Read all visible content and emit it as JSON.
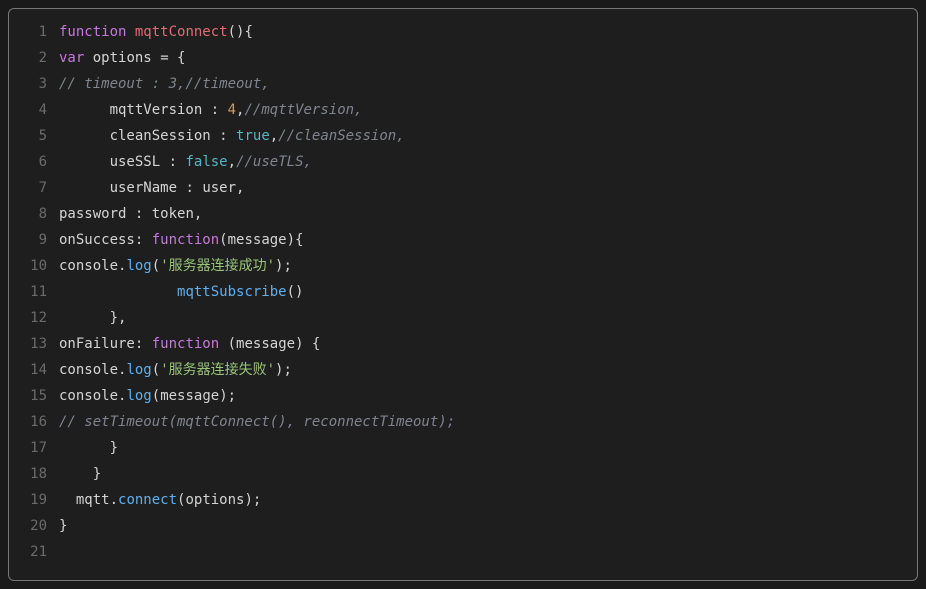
{
  "lines": [
    {
      "n": "1",
      "html": "<span class='kw'>function</span> <span class='fnname'>mqttConnect</span><span class='punc'>(){</span>"
    },
    {
      "n": "2",
      "html": "<span class='kw'>var</span> <span class='obj'>options</span> <span class='punc'>= {</span>"
    },
    {
      "n": "3",
      "html": "<span class='cmt'>// timeout : 3,//timeout,</span>"
    },
    {
      "n": "4",
      "html": "      <span class='prop'>mqttVersion</span> <span class='punc'>:</span> <span class='num'>4</span><span class='punc'>,</span><span class='cmt'>//mqttVersion,</span>"
    },
    {
      "n": "5",
      "html": "      <span class='prop'>cleanSession</span> <span class='punc'>:</span> <span class='bool'>true</span><span class='punc'>,</span><span class='cmt'>//cleanSession,</span>"
    },
    {
      "n": "6",
      "html": "      <span class='prop'>useSSL</span> <span class='punc'>:</span> <span class='bool'>false</span><span class='punc'>,</span><span class='cmt'>//useTLS,</span>"
    },
    {
      "n": "7",
      "html": "      <span class='prop'>userName</span> <span class='punc'>:</span> <span class='obj'>user</span><span class='punc'>,</span>"
    },
    {
      "n": "8",
      "html": "<span class='prop'>password</span> <span class='punc'>:</span> <span class='obj'>token</span><span class='punc'>,</span>"
    },
    {
      "n": "9",
      "html": "<span class='prop'>onSuccess</span><span class='punc'>:</span> <span class='kw'>function</span><span class='punc'>(</span><span class='obj'>message</span><span class='punc'>){</span>"
    },
    {
      "n": "10",
      "html": "<span class='obj'>console</span><span class='punc'>.</span><span class='fn'>log</span><span class='punc'>(</span><span class='str'>'服务器连接成功'</span><span class='punc'>);</span>"
    },
    {
      "n": "11",
      "html": "              <span class='call'>mqttSubscribe</span><span class='punc'>()</span>"
    },
    {
      "n": "12",
      "html": "      <span class='punc'>},</span>"
    },
    {
      "n": "13",
      "html": "<span class='prop'>onFailure</span><span class='punc'>:</span> <span class='kw'>function</span> <span class='punc'>(</span><span class='obj'>message</span><span class='punc'>) {</span>"
    },
    {
      "n": "14",
      "html": "<span class='obj'>console</span><span class='punc'>.</span><span class='fn'>log</span><span class='punc'>(</span><span class='str'>'服务器连接失败'</span><span class='punc'>);</span>"
    },
    {
      "n": "15",
      "html": "<span class='obj'>console</span><span class='punc'>.</span><span class='fn'>log</span><span class='punc'>(</span><span class='obj'>message</span><span class='punc'>);</span>"
    },
    {
      "n": "16",
      "html": "<span class='cmt'>// setTimeout(mqttConnect(), reconnectTimeout);</span>"
    },
    {
      "n": "17",
      "html": "      <span class='punc'>}</span>"
    },
    {
      "n": "18",
      "html": "    <span class='punc'>}</span>"
    },
    {
      "n": "19",
      "html": "  <span class='obj'>mqtt</span><span class='punc'>.</span><span class='fn'>connect</span><span class='punc'>(</span><span class='obj'>options</span><span class='punc'>);</span>"
    },
    {
      "n": "20",
      "html": "<span class='punc'>}</span>"
    },
    {
      "n": "21",
      "html": ""
    }
  ]
}
